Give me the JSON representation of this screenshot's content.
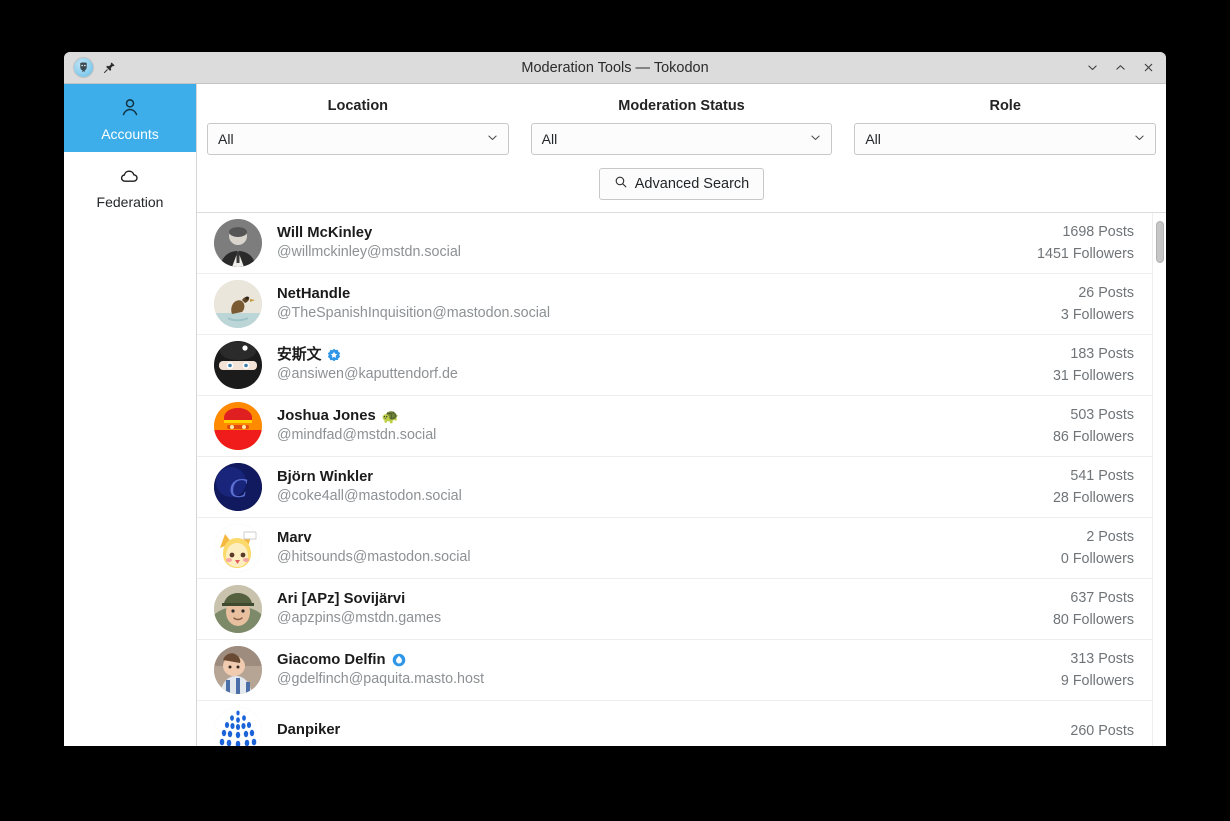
{
  "window": {
    "title": "Moderation Tools — Tokodon",
    "app_icon": "tokodon-icon",
    "pin_icon": "pin-icon",
    "controls": [
      {
        "name": "minimize-button",
        "icon": "chevron-down-icon",
        "glyph": "minimize"
      },
      {
        "name": "maximize-button",
        "icon": "chevron-up-icon",
        "glyph": "maximize"
      },
      {
        "name": "close-button",
        "icon": "close-icon",
        "glyph": "close"
      }
    ]
  },
  "colors": {
    "accent": "#3daee9",
    "titlebar": "#dcdcdc",
    "verified_badge": "#2f96e8",
    "handle_text": "#8d9194",
    "stats_text": "#6f7478"
  },
  "sidebar": {
    "items": [
      {
        "label": "Accounts",
        "icon": "person-icon",
        "active": true
      },
      {
        "label": "Federation",
        "icon": "cloud-icon",
        "active": false
      }
    ]
  },
  "filters": {
    "fields": [
      {
        "label": "Location",
        "value": "All",
        "name": "location-filter"
      },
      {
        "label": "Moderation Status",
        "value": "All",
        "name": "moderation-status-filter"
      },
      {
        "label": "Role",
        "value": "All",
        "name": "role-filter"
      }
    ],
    "advanced_search": {
      "label": "Advanced Search",
      "icon": "search-icon"
    }
  },
  "accounts": [
    {
      "name": "Will McKinley",
      "handle": "@willmckinley@mstdn.social",
      "posts": "1698 Posts",
      "followers": "1451 Followers",
      "badge": null,
      "emoji": null,
      "avatar": "photo-bw-portrait"
    },
    {
      "name": "NetHandle",
      "handle": "@TheSpanishInquisition@mastodon.social",
      "posts": "26 Posts",
      "followers": "3 Followers",
      "badge": null,
      "emoji": null,
      "avatar": "photo-duck"
    },
    {
      "name": "安斯文",
      "handle": "@ansiwen@kaputtendorf.de",
      "posts": "183 Posts",
      "followers": "31 Followers",
      "badge": "verified-star-icon",
      "emoji": null,
      "avatar": "photo-balaclava"
    },
    {
      "name": "Joshua Jones",
      "handle": "@mindfad@mstdn.social",
      "posts": "503 Posts",
      "followers": "86 Followers",
      "badge": null,
      "emoji": "🐢",
      "avatar": "photo-red-avatar"
    },
    {
      "name": "Björn Winkler",
      "handle": "@coke4all@mastodon.social",
      "posts": "541 Posts",
      "followers": "28 Followers",
      "badge": null,
      "emoji": null,
      "avatar": "logo-letter-c"
    },
    {
      "name": "Marv",
      "handle": "@hitsounds@mastodon.social",
      "posts": "2 Posts",
      "followers": "0 Followers",
      "badge": null,
      "emoji": null,
      "avatar": "anime-fox-girl"
    },
    {
      "name": "Ari [APz] Sovijärvi",
      "handle": "@apzpins@mstdn.games",
      "posts": "637 Posts",
      "followers": "80 Followers",
      "badge": null,
      "emoji": null,
      "avatar": "photo-man-cap"
    },
    {
      "name": "Giacomo Delfin",
      "handle": "@gdelfinch@paquita.masto.host",
      "posts": "313 Posts",
      "followers": "9 Followers",
      "badge": "blue-drop-icon",
      "emoji": null,
      "avatar": "photo-baby"
    },
    {
      "name": "Danpiker",
      "handle": "",
      "posts": "260 Posts",
      "followers": "",
      "badge": null,
      "emoji": null,
      "avatar": "blue-dots-pattern"
    }
  ],
  "scrollbar": {
    "name": "account-list-scrollbar",
    "position": "top"
  }
}
